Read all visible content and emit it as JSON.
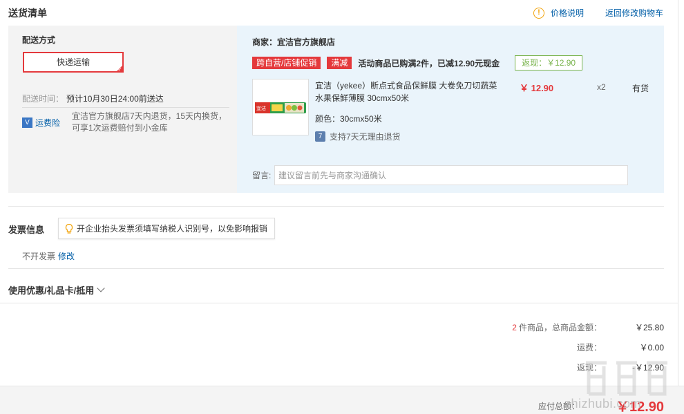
{
  "header": {
    "title": "送货清单",
    "price_info": "价格说明",
    "back_to_cart": "返回修改购物车"
  },
  "shipping": {
    "method_label": "配送方式",
    "method": "快递运输",
    "time_label": "配送时间：",
    "time_value": "预计10月30日24:00前送达",
    "insurance_label": "运费险",
    "insurance_text": "宜洁官方旗舰店7天内退货，15天内换货，可享1次运费赔付到小金库"
  },
  "order": {
    "merchant": "商家：宜洁官方旗舰店",
    "promo_tag1": "跨自营/店铺促销",
    "promo_tag2": "满减",
    "promo_text": "活动商品已购满2件，已减12.90元现金",
    "cashback": "返现：￥12.90",
    "product": {
      "title": "宜洁（yekee）断点式食品保鲜膜 大卷免刀切蔬菜水果保鲜薄膜 30cmx50米",
      "price": "￥ 12.90",
      "qty": "x2",
      "stock": "有货",
      "color": "颜色：30cmx50米",
      "return_policy": "支持7天无理由退货",
      "image_brand": "宜洁"
    },
    "note_label": "留言:",
    "note_placeholder": "建议留言前先与商家沟通确认"
  },
  "invoice": {
    "title": "发票信息",
    "tip": "开企业抬头发票须填写纳税人识别号，以免影响报销",
    "status": "不开发票",
    "edit": "修改"
  },
  "coupon": {
    "label": "使用优惠/礼品卡/抵用"
  },
  "summary": {
    "count": "2",
    "items_label": "件商品，总商品金额：",
    "items_total": "￥25.80",
    "freight_label": "运费：",
    "freight_value": "￥0.00",
    "cashback_label": "返现：",
    "cashback_value": "-￥12.90",
    "payable_label": "应付总额：",
    "payable_value": "￥12.90"
  },
  "watermark": {
    "site": "zhizhubi.com"
  },
  "colors": {
    "accent_red": "#e4393c",
    "link_blue": "#005ea7",
    "cashback_green": "#78b34b"
  }
}
